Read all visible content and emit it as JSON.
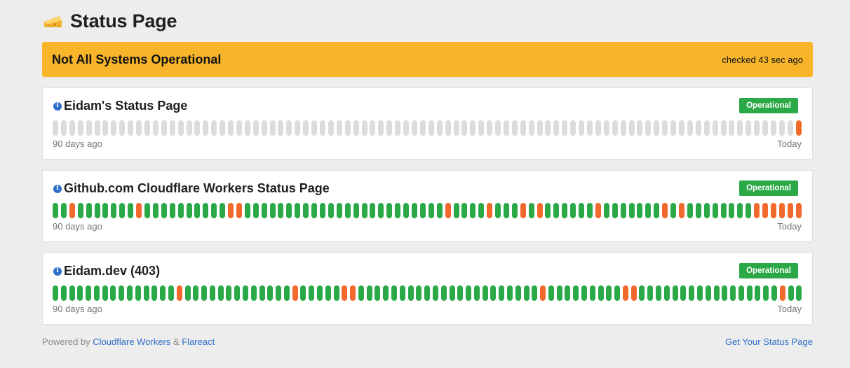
{
  "header": {
    "title": "Status Page",
    "logo_icon": "cheese-icon"
  },
  "banner": {
    "title": "Not All Systems Operational",
    "checked": "checked 43 sec ago",
    "color": "#f8b52a"
  },
  "monitors": [
    {
      "name": "Eidam's Status Page",
      "status": "Operational",
      "range_start": "90 days ago",
      "range_end": "Today",
      "days": "GGGGGGGGGGGGGGGGGGGGGGGGGGGGGGGGGGGGGGGGGGGGGGGGGGGGGGGGGGGGGGGGGGGGGGGGGGGGGGGGGGGGGGGGGO"
    },
    {
      "name": "Github.com Cloudflare Workers Status Page",
      "status": "Operational",
      "range_start": "90 days ago",
      "range_end": "Today",
      "days": "SSOSSSSSSSOSSSSSSSSSSOOSSSSSSSSSSSSSSSSSSSSSSSSOSSSSOSSSOSOSSSSSSOSSSSSSSOSOSSSSSSSSOOOOOO"
    },
    {
      "name": "Eidam.dev (403)",
      "status": "Operational",
      "range_start": "90 days ago",
      "range_end": "Today",
      "days": "SSSSSSSSSSSSSSSOSSSSSSSSSSSSSOSSSSSOOSSSSSSSSSSSSSSSSSSSSSSOSSSSSSSSSOOSSSSSSSSSSSSSSSSSOSS"
    }
  ],
  "legend_codes": {
    "G": "no-data",
    "S": "operational",
    "O": "incident"
  },
  "colors": {
    "operational": "#2ba947",
    "incident": "#f2692d",
    "no_data": "#dcdcdc",
    "link": "#2f6fcb"
  },
  "footer": {
    "powered_by": "Powered by",
    "link1": "Cloudflare Workers",
    "amp": "&",
    "link2": "Flareact",
    "cta": "Get Your Status Page"
  }
}
